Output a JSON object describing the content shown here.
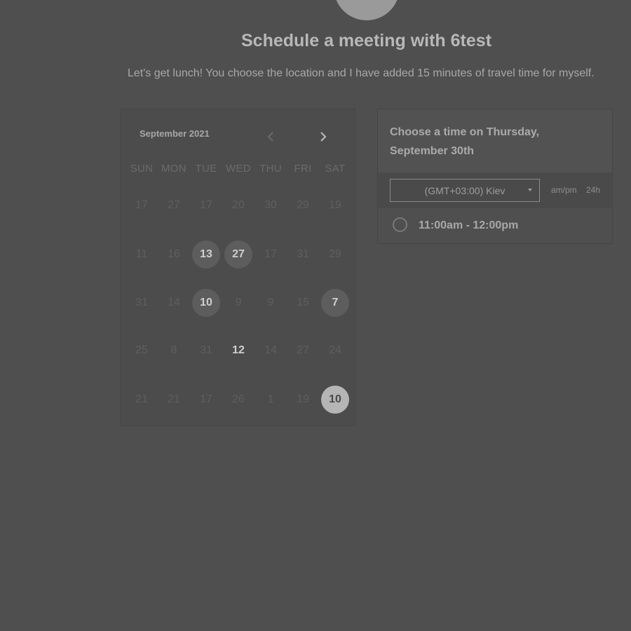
{
  "header": {
    "title": "Schedule a meeting with 6test",
    "subtitle": "Let's get lunch! You choose the location and I have added 15 minutes of travel time for myself."
  },
  "calendar": {
    "month_label": "September 2021",
    "prev_icon": "chevron-left-icon",
    "next_icon": "chevron-right-icon",
    "weekdays": [
      "SUN",
      "MON",
      "TUE",
      "WED",
      "THU",
      "FRI",
      "SAT"
    ],
    "weeks": [
      [
        "17",
        "27",
        "17",
        "20",
        "30",
        "29",
        "19"
      ],
      [
        "11",
        "16",
        "13",
        "27",
        "17",
        "31",
        "29"
      ],
      [
        "31",
        "14",
        "10",
        "9",
        "9",
        "15",
        "7"
      ],
      [
        "25",
        "8",
        "31",
        "12",
        "14",
        "27",
        "24"
      ],
      [
        "21",
        "21",
        "17",
        "26",
        "1",
        "19",
        "10"
      ]
    ],
    "available": [
      [
        1,
        2
      ],
      [
        1,
        3
      ],
      [
        2,
        2
      ],
      [
        2,
        6
      ],
      [
        3,
        3
      ]
    ],
    "selected": [
      4,
      6
    ]
  },
  "time_panel": {
    "title": "Choose a time on Thursday, September 30th",
    "timezone": "(GMT+03:00) Kiev",
    "format_ampm": "am/pm",
    "format_24h": "24h",
    "slots": [
      {
        "label": "11:00am - 12:00pm"
      }
    ]
  },
  "colors": {
    "background": "#4f4f4f",
    "selected_day": "#b5b5b5"
  }
}
